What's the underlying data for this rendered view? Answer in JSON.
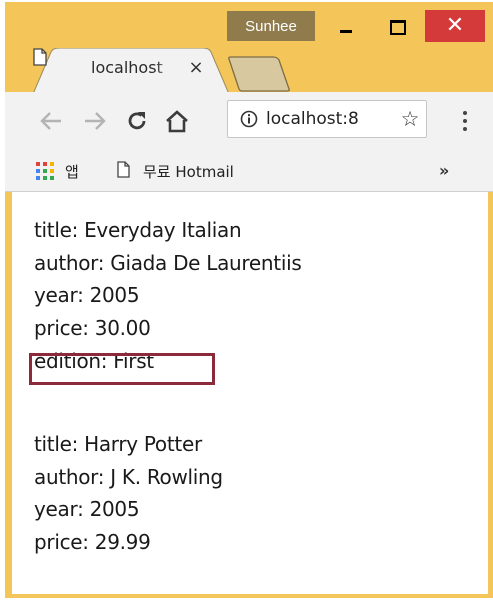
{
  "window": {
    "user_badge": "Sunhee",
    "tab": {
      "title": "localhost",
      "close_glyph": "×"
    },
    "toolbar": {
      "url": "localhost:8"
    },
    "bookmarks": {
      "apps_label": "앱",
      "items": [
        {
          "label": "무료 Hotmail"
        }
      ],
      "overflow": "»"
    }
  },
  "books": [
    {
      "title_line": "title: Everyday Italian",
      "author_line": "author: Giada De Laurentiis",
      "year_line": "year: 2005",
      "price_line": "price: 30.00",
      "edition_line": "edition: First"
    },
    {
      "title_line": "title: Harry Potter",
      "author_line": "author: J K. Rowling",
      "year_line": "year: 2005",
      "price_line": "price: 29.99"
    }
  ],
  "colors": {
    "window_frame": "#f4c558",
    "close_button": "#d43a3a",
    "highlight_box": "#8b2a3a"
  }
}
